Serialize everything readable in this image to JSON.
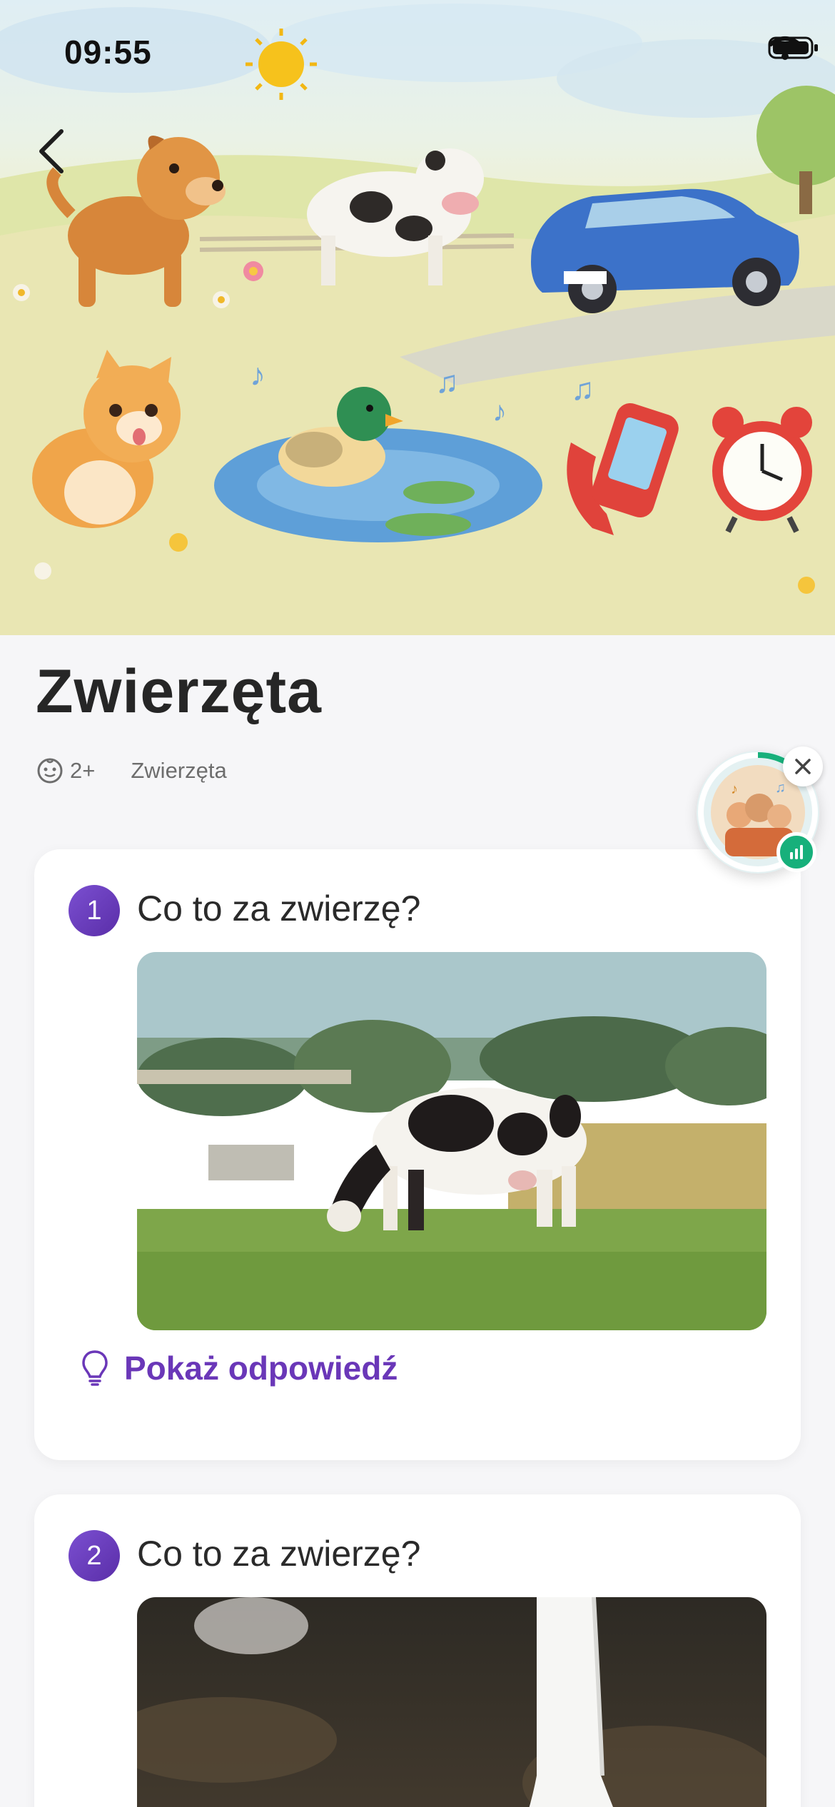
{
  "status_bar": {
    "time": "09:55"
  },
  "header": {
    "back_icon": "chevron-left-icon",
    "illustration": "animals-and-sounds-hero"
  },
  "page": {
    "title": "Zwierzęta",
    "age": "2+",
    "category": "Zwierzęta"
  },
  "mini_player": {
    "close_icon": "close-icon",
    "badge_icon": "equalizer-icon"
  },
  "questions": [
    {
      "number": "1",
      "text": "Co to za zwierzę?",
      "image": "cow-grazing-photo",
      "answer_label": "Pokaż odpowiedź"
    },
    {
      "number": "2",
      "text": "Co to za zwierzę?",
      "image": "white-bird-neck-photo"
    }
  ],
  "colors": {
    "accent": "#6a37b8",
    "badge": "#5a2ea8",
    "player_ring": "#17b07b"
  }
}
